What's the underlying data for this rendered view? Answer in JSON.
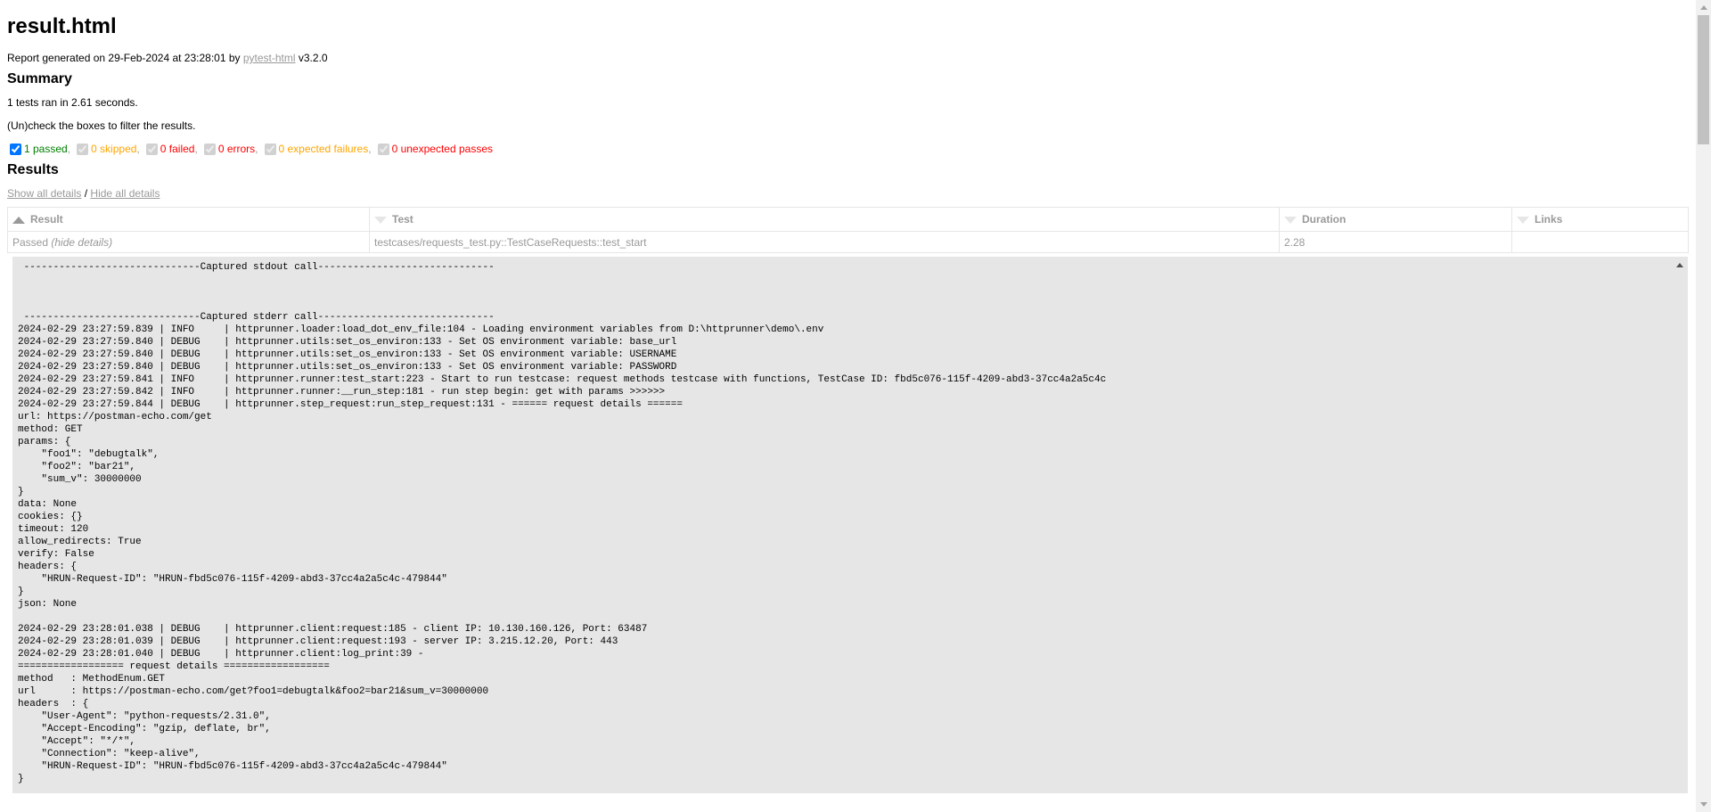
{
  "title": "result.html",
  "meta": {
    "prefix": "Report generated on 29-Feb-2024 at 23:28:01 by ",
    "tool_link": "pytest-html",
    "version": " v3.2.0"
  },
  "summary": {
    "heading": "Summary",
    "tests_ran": "1 tests ran in 2.61 seconds.",
    "filter_hint": "(Un)check the boxes to filter the results.",
    "filters": [
      {
        "label": "1 passed",
        "checked": true,
        "disabled": false
      },
      {
        "label": "0 skipped",
        "checked": true,
        "disabled": true
      },
      {
        "label": "0 failed",
        "checked": true,
        "disabled": true
      },
      {
        "label": "0 errors",
        "checked": true,
        "disabled": true
      },
      {
        "label": "0 expected failures",
        "checked": true,
        "disabled": true
      },
      {
        "label": "0 unexpected passes",
        "checked": true,
        "disabled": true
      }
    ],
    "separator": ","
  },
  "results": {
    "heading": "Results",
    "show_all": "Show all details",
    "divider": " / ",
    "hide_all": "Hide all details",
    "columns": [
      "Result",
      "Test",
      "Duration",
      "Links"
    ],
    "rows": [
      {
        "result": "Passed",
        "hide_details": "(hide details)",
        "test": "testcases/requests_test.py::TestCaseRequests::test_start",
        "duration": "2.28",
        "links": ""
      }
    ]
  },
  "log_lines": [
    " ------------------------------Captured stdout call------------------------------",
    "",
    "",
    "",
    " ------------------------------Captured stderr call------------------------------",
    "2024-02-29 23:27:59.839 | INFO     | httprunner.loader:load_dot_env_file:104 - Loading environment variables from D:\\httprunner\\demo\\.env",
    "2024-02-29 23:27:59.840 | DEBUG    | httprunner.utils:set_os_environ:133 - Set OS environment variable: base_url",
    "2024-02-29 23:27:59.840 | DEBUG    | httprunner.utils:set_os_environ:133 - Set OS environment variable: USERNAME",
    "2024-02-29 23:27:59.840 | DEBUG    | httprunner.utils:set_os_environ:133 - Set OS environment variable: PASSWORD",
    "2024-02-29 23:27:59.841 | INFO     | httprunner.runner:test_start:223 - Start to run testcase: request methods testcase with functions, TestCase ID: fbd5c076-115f-4209-abd3-37cc4a2a5c4c",
    "2024-02-29 23:27:59.842 | INFO     | httprunner.runner:__run_step:181 - run step begin: get with params >>>>>>",
    "2024-02-29 23:27:59.844 | DEBUG    | httprunner.step_request:run_step_request:131 - ====== request details ======",
    "url: https://postman-echo.com/get",
    "method: GET",
    "params: {",
    "    \"foo1\": \"debugtalk\",",
    "    \"foo2\": \"bar21\",",
    "    \"sum_v\": 30000000",
    "}",
    "data: None",
    "cookies: {}",
    "timeout: 120",
    "allow_redirects: True",
    "verify: False",
    "headers: {",
    "    \"HRUN-Request-ID\": \"HRUN-fbd5c076-115f-4209-abd3-37cc4a2a5c4c-479844\"",
    "}",
    "json: None",
    "",
    "2024-02-29 23:28:01.038 | DEBUG    | httprunner.client:request:185 - client IP: 10.130.160.126, Port: 63487",
    "2024-02-29 23:28:01.039 | DEBUG    | httprunner.client:request:193 - server IP: 3.215.12.20, Port: 443",
    "2024-02-29 23:28:01.040 | DEBUG    | httprunner.client:log_print:39 -",
    "================== request details ==================",
    "method   : MethodEnum.GET",
    "url      : https://postman-echo.com/get?foo1=debugtalk&foo2=bar21&sum_v=30000000",
    "headers  : {",
    "    \"User-Agent\": \"python-requests/2.31.0\",",
    "    \"Accept-Encoding\": \"gzip, deflate, br\",",
    "    \"Accept\": \"*/*\",",
    "    \"Connection\": \"keep-alive\",",
    "    \"HRUN-Request-ID\": \"HRUN-fbd5c076-115f-4209-abd3-37cc4a2a5c4c-479844\"",
    "}"
  ]
}
